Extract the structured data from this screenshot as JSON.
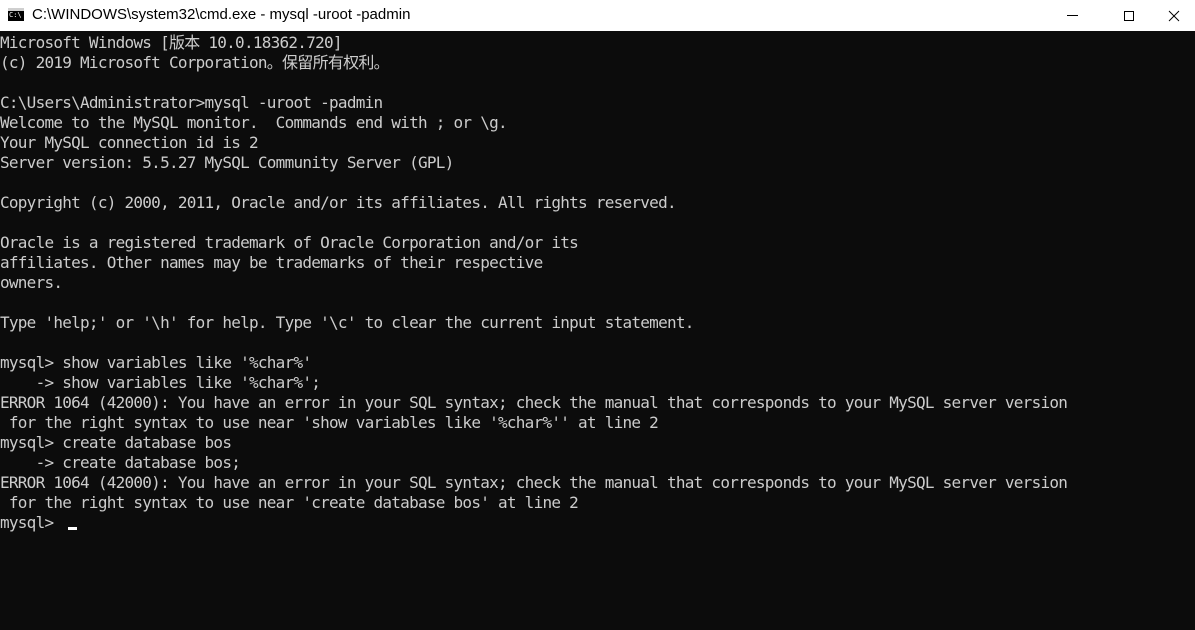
{
  "window": {
    "title": "C:\\WINDOWS\\system32\\cmd.exe - mysql  -uroot -padmin",
    "icon": "cmd-icon",
    "controls": {
      "minimize": "minimize-icon",
      "maximize": "maximize-icon",
      "close": "close-icon"
    }
  },
  "console": {
    "colors": {
      "background": "#0c0c0c",
      "text": "#cccccc",
      "cursor": "#ffffff"
    },
    "lines": [
      "Microsoft Windows [版本 10.0.18362.720]",
      "(c) 2019 Microsoft Corporation。保留所有权利。",
      "",
      "C:\\Users\\Administrator>mysql -uroot -padmin",
      "Welcome to the MySQL monitor.  Commands end with ; or \\g.",
      "Your MySQL connection id is 2",
      "Server version: 5.5.27 MySQL Community Server (GPL)",
      "",
      "Copyright (c) 2000, 2011, Oracle and/or its affiliates. All rights reserved.",
      "",
      "Oracle is a registered trademark of Oracle Corporation and/or its",
      "affiliates. Other names may be trademarks of their respective",
      "owners.",
      "",
      "Type 'help;' or '\\h' for help. Type '\\c' to clear the current input statement.",
      "",
      "mysql> show variables like '%char%'",
      "    -> show variables like '%char%';",
      "ERROR 1064 (42000): You have an error in your SQL syntax; check the manual that corresponds to your MySQL server version",
      " for the right syntax to use near 'show variables like '%char%'' at line 2",
      "mysql> create database bos",
      "    -> create database bos;",
      "ERROR 1064 (42000): You have an error in your SQL syntax; check the manual that corresponds to your MySQL server version",
      " for the right syntax to use near 'create database bos' at line 2",
      "mysql> "
    ]
  }
}
